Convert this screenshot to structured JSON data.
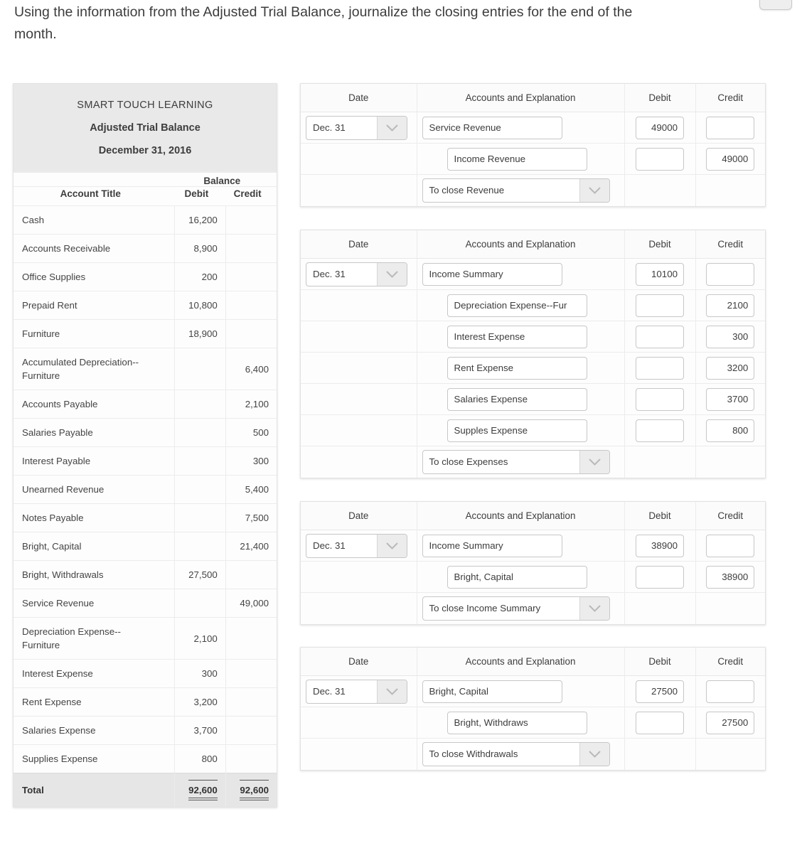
{
  "prompt": "Using the information from the Adjusted Trial Balance, journalize the closing entries for the end of the month.",
  "trial_balance": {
    "company": "SMART TOUCH LEARNING",
    "report": "Adjusted Trial Balance",
    "date": "December 31, 2016",
    "group_header": "Balance",
    "columns": {
      "account": "Account Title",
      "debit": "Debit",
      "credit": "Credit"
    },
    "rows": [
      {
        "account": "Cash",
        "debit": "16,200",
        "credit": ""
      },
      {
        "account": "Accounts Receivable",
        "debit": "8,900",
        "credit": ""
      },
      {
        "account": "Office Supplies",
        "debit": "200",
        "credit": ""
      },
      {
        "account": "Prepaid Rent",
        "debit": "10,800",
        "credit": ""
      },
      {
        "account": "Furniture",
        "debit": "18,900",
        "credit": ""
      },
      {
        "account": "Accumulated Depreciation--Furniture",
        "debit": "",
        "credit": "6,400"
      },
      {
        "account": "Accounts Payable",
        "debit": "",
        "credit": "2,100"
      },
      {
        "account": "Salaries Payable",
        "debit": "",
        "credit": "500"
      },
      {
        "account": "Interest Payable",
        "debit": "",
        "credit": "300"
      },
      {
        "account": "Unearned Revenue",
        "debit": "",
        "credit": "5,400"
      },
      {
        "account": "Notes Payable",
        "debit": "",
        "credit": "7,500"
      },
      {
        "account": "Bright, Capital",
        "debit": "",
        "credit": "21,400"
      },
      {
        "account": "Bright, Withdrawals",
        "debit": "27,500",
        "credit": ""
      },
      {
        "account": "Service Revenue",
        "debit": "",
        "credit": "49,000"
      },
      {
        "account": "Depreciation Expense--Furniture",
        "debit": "2,100",
        "credit": ""
      },
      {
        "account": "Interest Expense",
        "debit": "300",
        "credit": ""
      },
      {
        "account": "Rent Expense",
        "debit": "3,200",
        "credit": ""
      },
      {
        "account": "Salaries Expense",
        "debit": "3,700",
        "credit": ""
      },
      {
        "account": "Supplies Expense",
        "debit": "800",
        "credit": ""
      }
    ],
    "total": {
      "label": "Total",
      "debit": "92,600",
      "credit": "92,600"
    }
  },
  "journal_columns": {
    "date": "Date",
    "accounts": "Accounts and Explanation",
    "debit": "Debit",
    "credit": "Credit"
  },
  "journal_entries": [
    {
      "date": "Dec. 31",
      "lines": [
        {
          "account": "Service Revenue",
          "indent": false,
          "debit": "49000",
          "credit": ""
        },
        {
          "account": "Income Revenue",
          "indent": true,
          "debit": "",
          "credit": "49000"
        }
      ],
      "memo": "To close Revenue"
    },
    {
      "date": "Dec. 31",
      "lines": [
        {
          "account": "Income Summary",
          "indent": false,
          "debit": "10100",
          "credit": ""
        },
        {
          "account": "Depreciation Expense--Fur",
          "indent": true,
          "debit": "",
          "credit": "2100"
        },
        {
          "account": "Interest Expense",
          "indent": true,
          "debit": "",
          "credit": "300"
        },
        {
          "account": "Rent Expense",
          "indent": true,
          "debit": "",
          "credit": "3200"
        },
        {
          "account": "Salaries Expense",
          "indent": true,
          "debit": "",
          "credit": "3700"
        },
        {
          "account": "Supples Expense",
          "indent": true,
          "debit": "",
          "credit": "800"
        }
      ],
      "memo": "To close Expenses"
    },
    {
      "date": "Dec. 31",
      "lines": [
        {
          "account": "Income Summary",
          "indent": false,
          "debit": "38900",
          "credit": ""
        },
        {
          "account": "Bright, Capital",
          "indent": true,
          "debit": "",
          "credit": "38900"
        }
      ],
      "memo": "To close Income Summary"
    },
    {
      "date": "Dec. 31",
      "lines": [
        {
          "account": "Bright, Capital",
          "indent": false,
          "debit": "27500",
          "credit": ""
        },
        {
          "account": "Bright, Withdraws",
          "indent": true,
          "debit": "",
          "credit": "27500"
        }
      ],
      "memo": "To close Withdrawals"
    }
  ],
  "icons": {
    "dropdown": "chevron-down-icon"
  },
  "colors": {
    "header_bg": "#e9e9e9",
    "total_bg": "#e6e6e6",
    "border": "#ececec",
    "text": "#3d3d3d"
  }
}
